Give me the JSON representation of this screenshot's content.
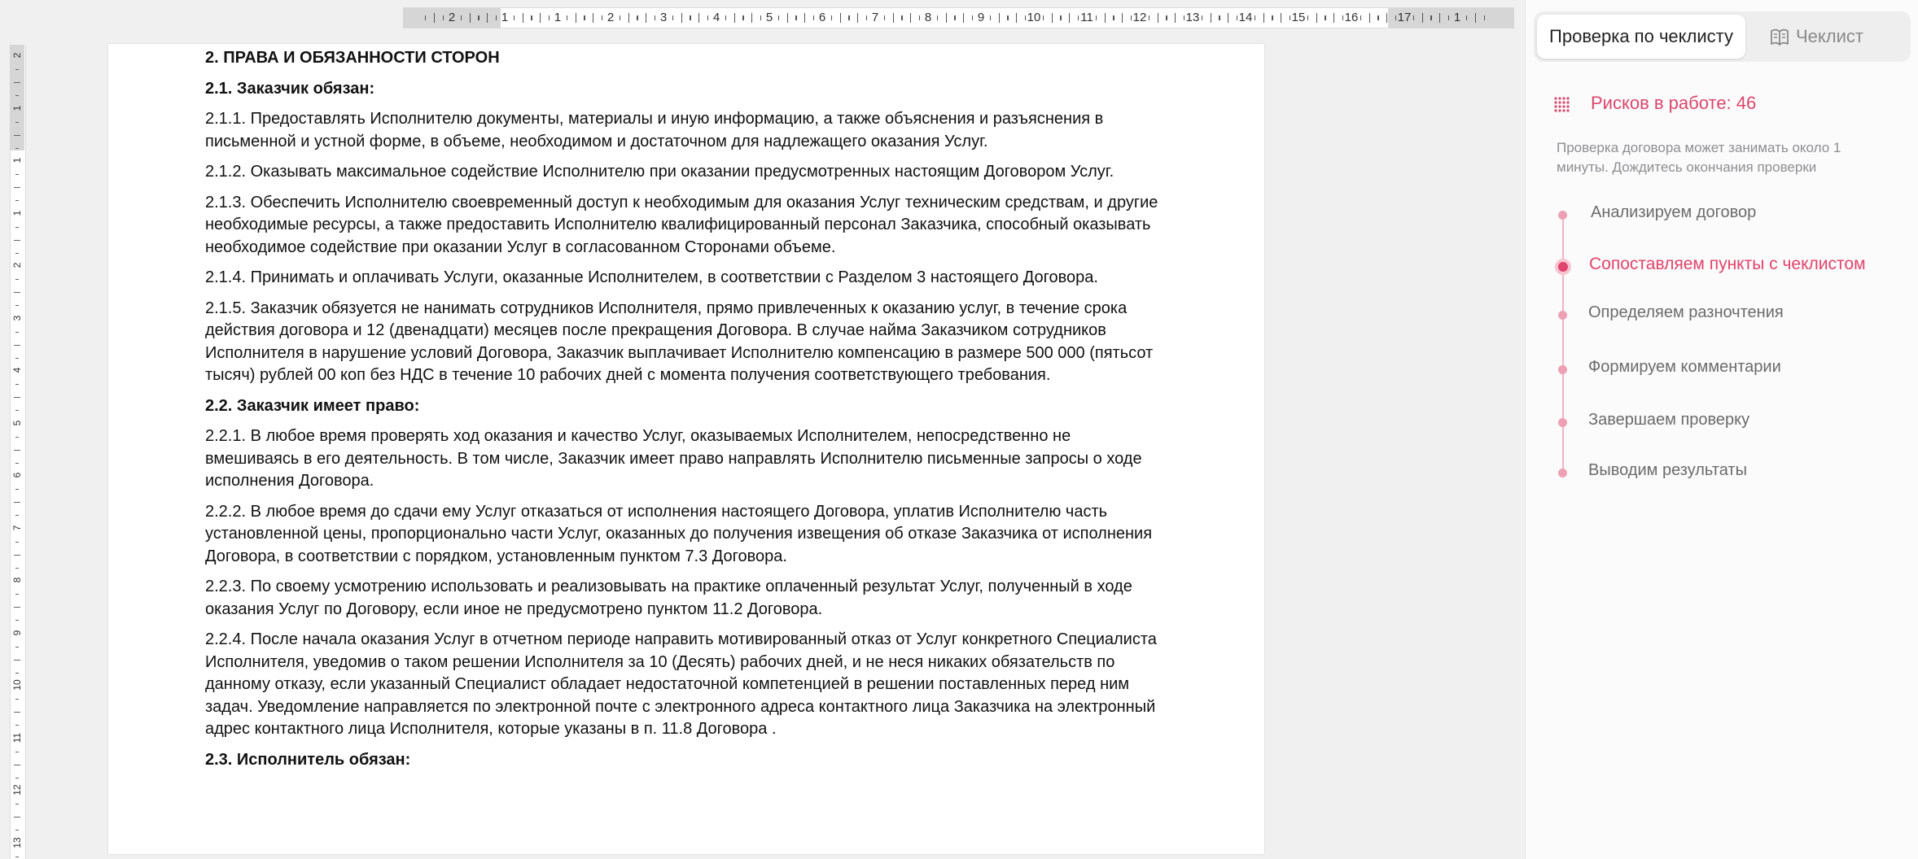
{
  "ruler": {
    "horizontal_labels": [
      "2",
      "1",
      "1",
      "2",
      "3",
      "4",
      "5",
      "6",
      "7",
      "8",
      "9",
      "10",
      "11",
      "12",
      "13",
      "14",
      "15",
      "16",
      "17",
      "1"
    ],
    "vertical_labels": [
      "2",
      "1",
      "1",
      "1",
      "2",
      "3",
      "4",
      "5",
      "6",
      "7",
      "8",
      "9",
      "10",
      "11",
      "12",
      "13"
    ]
  },
  "document": {
    "paragraphs": [
      {
        "style": "h",
        "text": "2. ПРАВА И ОБЯЗАННОСТИ СТОРОН"
      },
      {
        "style": "h",
        "text": "2.1. Заказчик обязан:"
      },
      {
        "style": "p",
        "text": "2.1.1. Предоставлять Исполнителю документы, материалы и иную информацию, а также объяснения и разъяснения в письменной и устной форме, в объеме, необходимом и достаточном для надлежащего оказания  Услуг."
      },
      {
        "style": "p",
        "text": "2.1.2. Оказывать максимальное содействие Исполнителю при оказании предусмотренных настоящим Договором Услуг."
      },
      {
        "style": "p",
        "text": "2.1.3. Обеспечить Исполнителю своевременный доступ к необходимым для оказания Услуг техническим средствам, и другие необходимые ресурсы, а также предоставить Исполнителю квалифицированный персонал Заказчика, способный оказывать необходимое содействие при оказании Услуг в согласованном Сторонами объеме."
      },
      {
        "style": "p",
        "text": "2.1.4. Принимать и оплачивать Услуги, оказанные Исполнителем, в соответствии с Разделом 3 настоящего Договора."
      },
      {
        "style": "p",
        "text": "2.1.5. Заказчик обязуется не нанимать сотрудников Исполнителя, прямо привлеченных к оказанию услуг, в течение срока действия договора и 12 (двенадцати) месяцев после прекращения Договора. В случае найма Заказчиком сотрудников Исполнителя в нарушение условий Договора, Заказчик выплачивает Исполнителю компенсацию в размере 500 000 (пятьсот тысяч) рублей 00 коп без НДС в течение 10 рабочих дней с момента получения соответствующего требования."
      },
      {
        "style": "h",
        "text": "2.2. Заказчик имеет право:"
      },
      {
        "style": "p",
        "text": "2.2.1. В любое время проверять ход оказания и качество Услуг, оказываемых Исполнителем, непосредственно не вмешиваясь в его деятельность. В том числе, Заказчик имеет право направлять Исполнителю письменные запросы о ходе исполнения Договора."
      },
      {
        "style": "p",
        "text": "2.2.2. В любое время до сдачи ему Услуг отказаться от исполнения настоящего Договора, уплатив Исполнителю часть установленной цены, пропорционально части Услуг, оказанных до получения извещения об отказе Заказчика от исполнения Договора, в соответствии с порядком, установленным пунктом 7.3 Договора."
      },
      {
        "style": "p",
        "text": "2.2.3. По своему усмотрению использовать и реализовывать на практике оплаченный результат Услуг, полученный в ходе оказания Услуг по Договору, если иное не предусмотрено пунктом 11.2 Договора."
      },
      {
        "style": "p",
        "text": "2.2.4. После начала оказания Услуг в отчетном периоде направить мотивированный отказ от Услуг конкретного Специалиста  Исполнителя, уведомив о таком решении Исполнителя за 10 (Десять)  рабочих дней, и не неся никаких обязательств по данному отказу, если указанный Специалист обладает недостаточной компетенцией в решении поставленных перед ним задач. Уведомление направляется по электронной почте с электронного адреса контактного лица Заказчика на электронный  адрес контактного лица Исполнителя, которые указаны в п. 11.8 Договора ."
      },
      {
        "style": "h",
        "text": "2.3. Исполнитель обязан:"
      }
    ]
  },
  "panel": {
    "tab_check": "Проверка по чеклисту",
    "tab_list": "Чеклист",
    "tab_list_icon": "book-icon",
    "risk_icon": "dots-grid-icon",
    "risk_label": "Рисков в работе: 46",
    "note": "Проверка договора может занимать около 1 минуты. Дождитесь окончания проверки",
    "accent_color": "#e2436c",
    "steps": [
      {
        "label": "Анализируем договор",
        "status": "done"
      },
      {
        "label": "Сопоставляем пункты с чеклистом",
        "status": "active"
      },
      {
        "label": "Определяем разночтения",
        "status": "pending"
      },
      {
        "label": "Формируем комментарии",
        "status": "pending"
      },
      {
        "label": "Завершаем проверку",
        "status": "pending"
      },
      {
        "label": "Выводим результаты",
        "status": "pending"
      }
    ]
  }
}
